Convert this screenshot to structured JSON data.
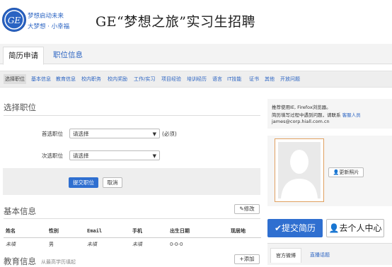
{
  "header": {
    "logo_text": "GE",
    "slogan_line1": "梦想启动未来",
    "slogan_line2": "大梦想 · 小幸福",
    "title": "GE“梦想之旅”实习生招聘"
  },
  "main_tabs": [
    {
      "label": "简历申请"
    },
    {
      "label": "职位信息"
    }
  ],
  "subnav": [
    {
      "label": "选择职位"
    },
    {
      "label": "基本信息"
    },
    {
      "label": "教育信息"
    },
    {
      "label": "校内职务"
    },
    {
      "label": "校内奖励"
    },
    {
      "label": "工作/实习"
    },
    {
      "label": "项目经验"
    },
    {
      "label": "培训经历"
    },
    {
      "label": "语言"
    },
    {
      "label": "IT技能"
    },
    {
      "label": "证书"
    },
    {
      "label": "其他"
    },
    {
      "label": "开放问题"
    }
  ],
  "select_position": {
    "title": "选择职位",
    "first_label": "首选职位",
    "first_value": "请选择",
    "required_note": "(必须)",
    "second_label": "次选职位",
    "second_value": "请选择",
    "submit_label": "提交职位",
    "cancel_label": "取消"
  },
  "basic_info": {
    "title": "基本信息",
    "edit_label": "修改",
    "columns": [
      "姓名",
      "性别",
      "Email",
      "手机",
      "出生日期",
      "现居地"
    ],
    "row": [
      "未填",
      "男",
      "未填",
      "未填",
      "0-0-0",
      ""
    ]
  },
  "education": {
    "title": "教育信息",
    "hint": "从最高学历填起",
    "add_label": "添加"
  },
  "sidebar": {
    "browser_note": "推荐使用IE, Firefox浏览器。",
    "help_prefix": "简历填写过程中遇到问题，请联系",
    "help_link": "客服人员",
    "email": "james@corp.hiall.com.cn",
    "update_photo_label": "更新照片",
    "submit_resume_label": "提交简历",
    "personal_center_label": "去个人中心",
    "weibo_tabs": [
      "官方微博",
      "直播话题"
    ]
  },
  "colors": {
    "brand": "#2a63c2",
    "primary_button": "#2f6fd0",
    "photo_border": "#e0a060"
  }
}
